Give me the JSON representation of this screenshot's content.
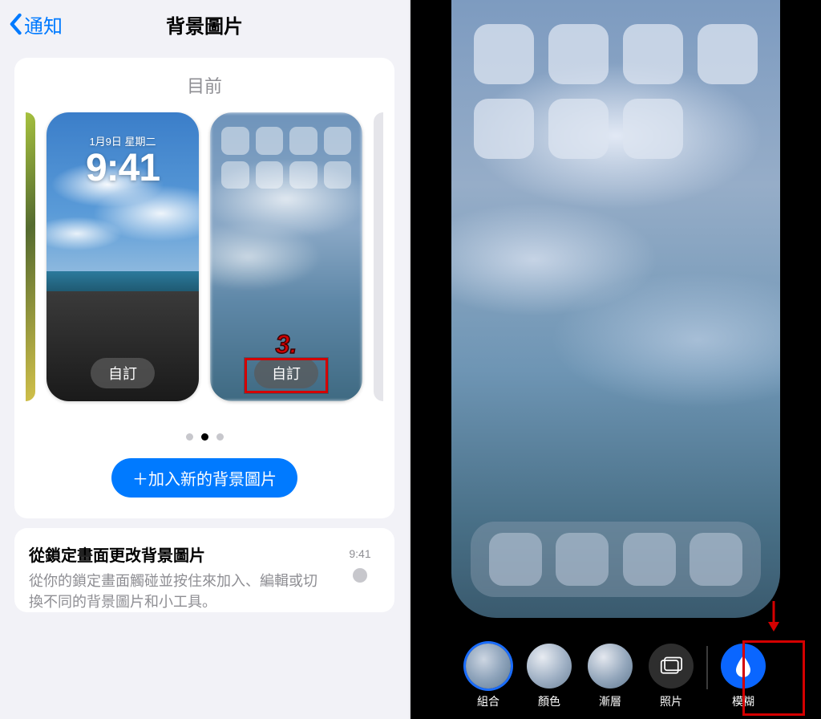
{
  "nav": {
    "back_label": "通知",
    "title": "背景圖片"
  },
  "current": {
    "section_label": "目前",
    "lock": {
      "date": "1月9日 星期二",
      "time": "9:41",
      "customize": "自訂"
    },
    "home": {
      "customize": "自訂"
    },
    "step_marker": "3.",
    "add_new": "＋加入新的背景圖片"
  },
  "tip": {
    "title": "從鎖定畫面更改背景圖片",
    "body": "從你的鎖定畫面觸碰並按住來加入、編輯或切換不同的背景圖片和小工具。",
    "mini_time": "9:41"
  },
  "editor": {
    "toolbar": {
      "sets": "組合",
      "color": "顏色",
      "gradient": "漸層",
      "photo": "照片",
      "blur": "模糊"
    }
  }
}
